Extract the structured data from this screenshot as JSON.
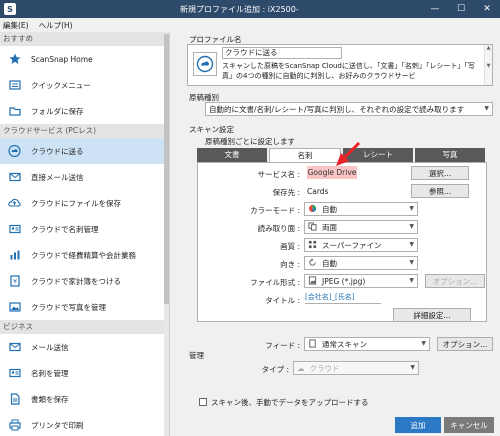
{
  "window": {
    "title": "新規プロファイル追加 : iX2500-"
  },
  "menu": {
    "items": [
      "編集(E)",
      "ヘルプ(H)"
    ]
  },
  "sidebar": {
    "sections": [
      {
        "header": "おすすめ",
        "items": [
          {
            "label": "ScanSnap Home",
            "icon": "star-icon"
          },
          {
            "label": "クイックメニュー",
            "icon": "quick-menu-icon"
          },
          {
            "label": "フォルダに保存",
            "icon": "folder-icon"
          }
        ]
      },
      {
        "header": "クラウドサービス (PCレス)",
        "items": [
          {
            "label": "クラウドに送る",
            "icon": "cloud-icon",
            "selected": true
          },
          {
            "label": "直接メール送信",
            "icon": "mail-icon"
          },
          {
            "label": "クラウドにファイルを保存",
            "icon": "cloud-upload-icon"
          },
          {
            "label": "クラウドで名刺管理",
            "icon": "business-card-icon"
          },
          {
            "label": "クラウドで経費精算や会計業務",
            "icon": "accounting-icon"
          },
          {
            "label": "クラウドで家計簿をつける",
            "icon": "household-icon"
          },
          {
            "label": "クラウドで写真を管理",
            "icon": "photo-icon"
          }
        ]
      },
      {
        "header": "ビジネス",
        "items": [
          {
            "label": "メール送信",
            "icon": "mail-icon"
          },
          {
            "label": "名刺を管理",
            "icon": "business-card-icon"
          },
          {
            "label": "書類を保存",
            "icon": "document-icon"
          },
          {
            "label": "プリンタで印刷",
            "icon": "printer-icon"
          }
        ]
      }
    ]
  },
  "main": {
    "profile_label": "プロファイル名",
    "profile_name": "クラウドに送る",
    "profile_desc": "スキャンした原稿をScanSnap Cloudに送信し、「文書」「名刺」「レシート」「写真」の4つの種別に自動的に判別し、お好みのクラウドサービ",
    "doc_type_label": "原稿種別",
    "doc_type_value": "自動的に文書/名刺/レシート/写真に判別し、それぞれの設定で読み取ります",
    "scan_settings_label": "スキャン設定",
    "per_type_label": "原稿種別ごとに設定します",
    "tabs": [
      "文書",
      "名刺",
      "レシート",
      "写真"
    ],
    "service_label": "サービス名 :",
    "service_value": "Google Drive",
    "select_button": "選択...",
    "save_label": "保存先 :",
    "save_value": "Cards",
    "browse_button": "参照...",
    "color_label": "カラーモード :",
    "color_value": "自動",
    "side_label": "読み取り面 :",
    "side_value": "両面",
    "quality_label": "画質 :",
    "quality_value": "スーパーファイン",
    "orientation_label": "向き :",
    "orientation_value": "自動",
    "format_label": "ファイル形式 :",
    "format_value": "JPEG (*.jpg)",
    "options_button": "オプション...",
    "title_label": "タイトル :",
    "title_value": "[会社名]_[氏名]",
    "detail_button": "詳細設定...",
    "feed_label": "フィード :",
    "feed_value": "通常スキャン",
    "feed_options_button": "オプション...",
    "manage_label": "管理",
    "type_label": "タイプ :",
    "type_value": "クラウド",
    "upload_checkbox": "スキャン後、手動でデータをアップロードする",
    "add_button": "追加",
    "cancel_button": "キャンセル"
  },
  "colors": {
    "titlebar": "#2e4a6b",
    "selected": "#cde3f5",
    "accent": "#1f6fb2",
    "service_bg": "#f9c5c5",
    "tab_dark": "#595959",
    "add_button": "#2b78c4",
    "cancel_button": "#7a7a7a",
    "arrow": "#e8232a"
  }
}
